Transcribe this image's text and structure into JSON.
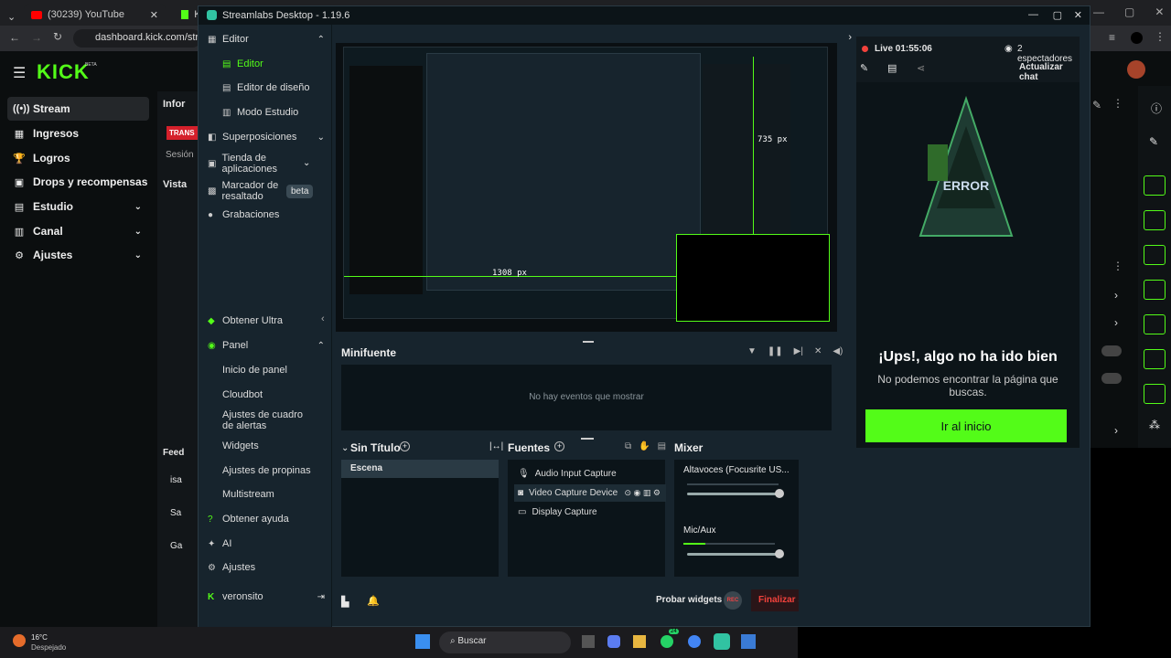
{
  "browser": {
    "tabs": [
      {
        "label": "(30239) YouTube"
      },
      {
        "label": "Ki"
      }
    ],
    "url": "dashboard.kick.com/stream"
  },
  "kick": {
    "logo": "KICK",
    "logo_badge": "BETA",
    "nav": [
      {
        "label": "Stream",
        "icon": "broadcast-icon",
        "active": true
      },
      {
        "label": "Ingresos",
        "icon": "money-icon"
      },
      {
        "label": "Logros",
        "icon": "trophy-icon"
      },
      {
        "label": "Drops y recompensas",
        "icon": "gift-icon"
      },
      {
        "label": "Estudio",
        "icon": "studio-icon",
        "expandable": true
      },
      {
        "label": "Canal",
        "icon": "channel-icon",
        "expandable": true
      },
      {
        "label": "Ajustes",
        "icon": "gear-icon",
        "expandable": true
      }
    ],
    "partial": {
      "info": "Infor",
      "badge": "TRANS",
      "session": "Sesión",
      "vista": "Vista",
      "feed": "Feed",
      "users": [
        "isa",
        "Sa",
        "Ga"
      ]
    }
  },
  "streamlabs": {
    "title": "Streamlabs Desktop - 1.19.6",
    "sidebar": [
      {
        "label": "Editor",
        "icon": "editor-icon",
        "expanded": true
      },
      {
        "label": "Editor",
        "sub": true,
        "active": true
      },
      {
        "label": "Editor de diseño",
        "sub": true
      },
      {
        "label": "Modo Estudio",
        "sub": true
      },
      {
        "label": "Superposiciones",
        "icon": "overlay-icon",
        "expandable": true
      },
      {
        "label": "Tienda de aplicaciones",
        "icon": "store-icon",
        "expandable": true
      },
      {
        "label": "Marcador de resaltado",
        "icon": "highlight-icon",
        "badge": "beta"
      },
      {
        "label": "Grabaciones",
        "icon": "recordings-icon"
      },
      {
        "label": "Obtener Ultra",
        "icon": "ultra-icon"
      },
      {
        "label": "Panel",
        "icon": "panel-icon",
        "expanded": true
      },
      {
        "label": "Inicio de panel",
        "sub": true
      },
      {
        "label": "Cloudbot",
        "sub": true
      },
      {
        "label": "Ajustes de cuadro de alertas",
        "sub": true
      },
      {
        "label": "Widgets",
        "sub": true
      },
      {
        "label": "Ajustes de propinas",
        "sub": true
      },
      {
        "label": "Multistream",
        "sub": true
      },
      {
        "label": "Obtener ayuda",
        "icon": "help-icon"
      },
      {
        "label": "AI",
        "icon": "ai-icon"
      },
      {
        "label": "Ajustes",
        "icon": "gear-icon"
      }
    ],
    "user": "veronsito",
    "preview": {
      "dim_w": "1308 px",
      "dim_h": "735 px"
    },
    "minifeed": {
      "title": "Minifuente",
      "empty": "No hay eventos que mostrar"
    },
    "scenes": {
      "title": "Sin Título",
      "items": [
        "Escena"
      ]
    },
    "sources": {
      "title": "Fuentes",
      "items": [
        {
          "label": "Audio Input Capture",
          "icon": "mic-icon"
        },
        {
          "label": "Video Capture Device",
          "icon": "camera-icon",
          "selected": true
        },
        {
          "label": "Display Capture",
          "icon": "monitor-icon"
        }
      ]
    },
    "mixer": {
      "title": "Mixer",
      "channels": [
        {
          "label": "Altavoces (Focusrite US...",
          "volume": 1.0
        },
        {
          "label": "Mic/Aux",
          "volume": 1.0
        }
      ]
    },
    "footer": {
      "test_widgets": "Probar widgets",
      "rec": "REC",
      "end": "Finalizar s"
    },
    "chat": {
      "live": "Live 01:55:06",
      "viewers": "2 espectadores",
      "refresh": "Actualizar chat",
      "error_title": "¡Ups!, algo no ha ido bien",
      "error_body": "No podemos encontrar la página que buscas.",
      "error_button": "Ir al inicio",
      "error_sign": "ERROR"
    }
  },
  "taskbar": {
    "temp": "16°C",
    "weather": "Despejado",
    "search": "Buscar",
    "badge": "24"
  },
  "colors": {
    "kick_green": "#53fc18",
    "bg": "#17242d"
  }
}
